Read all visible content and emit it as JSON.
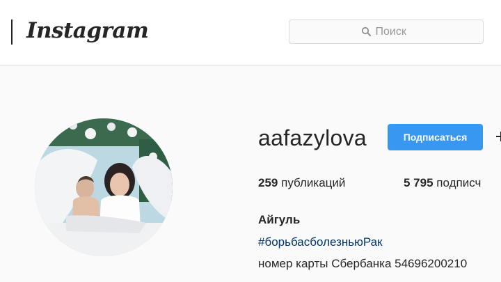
{
  "header": {
    "logo_text": "Instagram",
    "search": {
      "placeholder": "Поиск"
    }
  },
  "profile": {
    "username": "aafazylova",
    "follow_label": "Подписаться",
    "more_icon": "more-icon",
    "stats": {
      "posts_count": "259",
      "posts_label": "публикаций",
      "followers_count": "5 795",
      "followers_label": "подписч"
    },
    "full_name": "Айгуль",
    "hashtag": "#борьбасболезньюРак",
    "bio_line": "номер карты Сбербанка 54696200210"
  },
  "colors": {
    "accent": "#3897f0",
    "hashtag": "#003569",
    "border": "#dbdbdb",
    "background": "#fafafa"
  },
  "icons": [
    "search-icon",
    "avatar",
    "more-icon"
  ]
}
